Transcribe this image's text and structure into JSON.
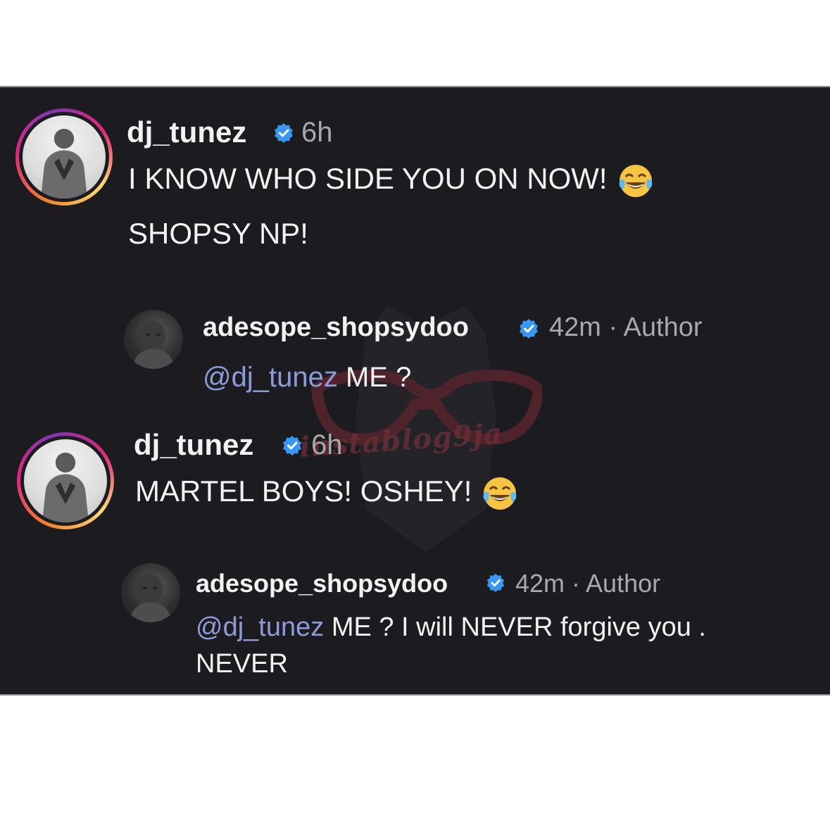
{
  "comments": [
    {
      "username": "dj_tunez",
      "time": "6h",
      "text_line1": "I KNOW WHO SIDE YOU ON NOW!",
      "text_line2": "SHOPSY NP!",
      "emoji": "face-with-tears-of-joy-icon"
    },
    {
      "username": "adesope_shopsydoo",
      "time": "42m · Author",
      "mention": "@dj_tunez",
      "text": "ME ?"
    },
    {
      "username": "dj_tunez",
      "time": "6h",
      "text_line1": "MARTEL BOYS! OSHEY!",
      "emoji": "face-with-tears-of-joy-icon"
    },
    {
      "username": "adesope_shopsydoo",
      "time": "42m · Author",
      "mention": "@dj_tunez",
      "text_line1": "ME ? I will NEVER forgive you .",
      "text_line2": "NEVER"
    }
  ],
  "watermark": "instablog9ja",
  "colors": {
    "background": "#1c1c20",
    "text": "#f2f2f2",
    "mention": "#8e9bd9",
    "verified": "#3897f0",
    "muted": "#a8a8ad"
  }
}
